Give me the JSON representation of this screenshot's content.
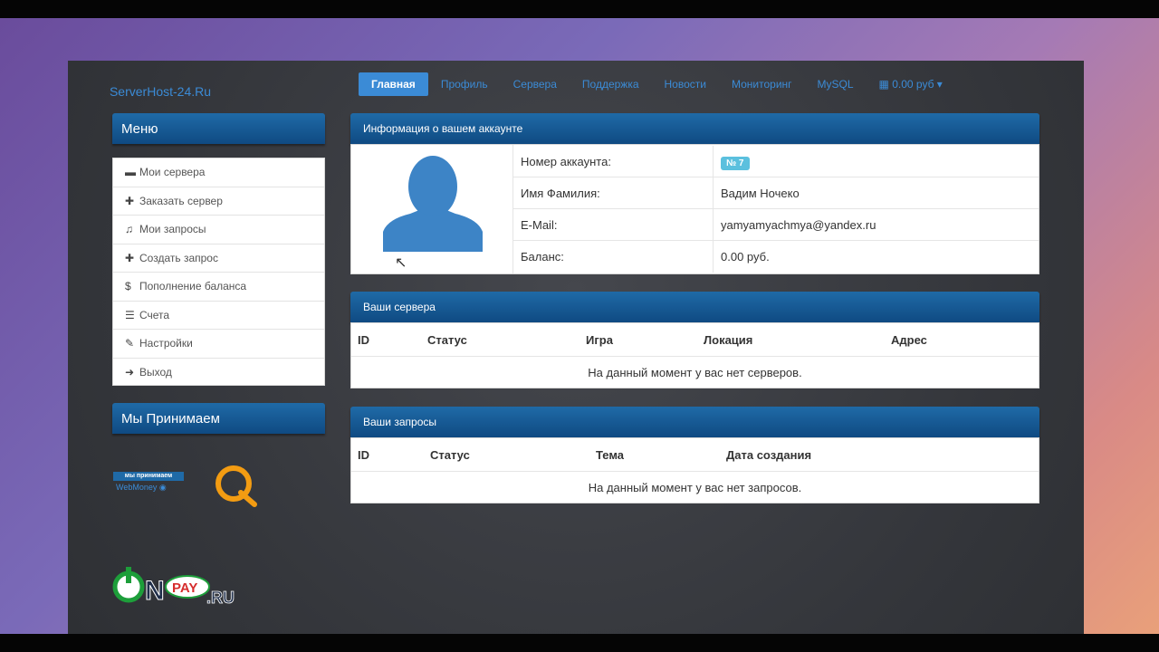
{
  "site": {
    "logo": "ServerHost-24.Ru"
  },
  "nav": {
    "items": [
      "Главная",
      "Профиль",
      "Сервера",
      "Поддержка",
      "Новости",
      "Мониторинг",
      "MySQL"
    ],
    "balance": "0.00 руб"
  },
  "sidebar": {
    "menu_title": "Меню",
    "items": [
      {
        "icon": "▬",
        "label": "Мои сервера"
      },
      {
        "icon": "✚",
        "label": "Заказать сервер"
      },
      {
        "icon": "♫",
        "label": "Мои запросы"
      },
      {
        "icon": "✚",
        "label": "Создать запрос"
      },
      {
        "icon": "$",
        "label": "Пополнение баланса"
      },
      {
        "icon": "☰",
        "label": "Счета"
      },
      {
        "icon": "✎",
        "label": "Настройки"
      },
      {
        "icon": "➜",
        "label": "Выход"
      }
    ],
    "accept_title": "Мы Принимаем",
    "webmoney_badge": "мы принимаем",
    "webmoney_text": "WebMoney",
    "onpay": "ON PAY.RU"
  },
  "account": {
    "title": "Информация о вашем аккаунте",
    "rows": [
      {
        "label": "Номер аккаунта:",
        "value": "№ 7"
      },
      {
        "label": "Имя Фамилия:",
        "value": "Вадим Ночеко"
      },
      {
        "label": "E-Mail:",
        "value": "yamyamyachmya@yandex.ru"
      },
      {
        "label": "Баланс:",
        "value": "0.00 руб."
      }
    ]
  },
  "servers": {
    "title": "Ваши сервера",
    "columns": [
      "ID",
      "Статус",
      "Игра",
      "Локация",
      "Адрес"
    ],
    "empty": "На данный момент у вас нет серверов."
  },
  "requests": {
    "title": "Ваши запросы",
    "columns": [
      "ID",
      "Статус",
      "Тема",
      "Дата создания"
    ],
    "empty": "На данный момент у вас нет запросов."
  }
}
